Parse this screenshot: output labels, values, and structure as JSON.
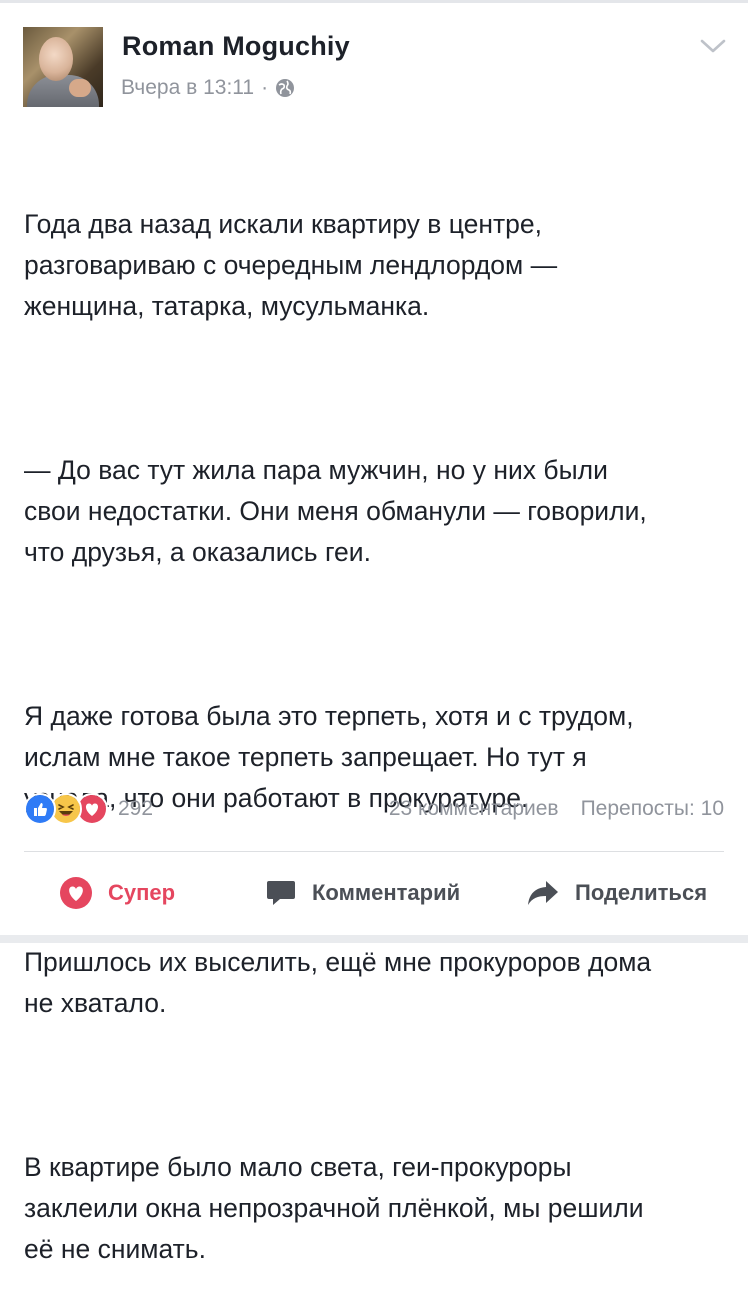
{
  "post": {
    "author": "Roman Moguchiy",
    "time": "Вчера в 13:11",
    "separator": "·",
    "paragraphs": [
      "Года два назад искали квартиру в центре,\nразговариваю с очередным лендлордом —\nженщина, татарка, мусульманка.",
      "— До вас тут жила пара мужчин, но у них были\nсвои недостатки. Они меня обманули — говорили,\nчто друзья, а оказались геи.",
      "Я даже готова была это терпеть, хотя и с трудом,\nислам мне такое терпеть запрещает. Но тут я\nузнала, что они работают в прокуратуре.",
      "Пришлось их выселить, ещё мне прокуроров дома\nне хватало.",
      "В квартире было мало света, геи-прокуроры\nзаклеили окна непрозрачной плёнкой, мы решили\nеё не снимать."
    ]
  },
  "reactions": {
    "count": "292",
    "types": [
      "like-icon",
      "haha-icon",
      "love-icon"
    ]
  },
  "stats": {
    "comments": "23 комментариев",
    "shares": "Перепосты: 10"
  },
  "actions": {
    "super": "Супер",
    "comment": "Комментарий",
    "share": "Поделиться"
  },
  "colors": {
    "text": "#1d2129",
    "meta": "#90949c",
    "like": "#2f7bf6",
    "love": "#e5465f",
    "haha": "#f7c64a"
  }
}
